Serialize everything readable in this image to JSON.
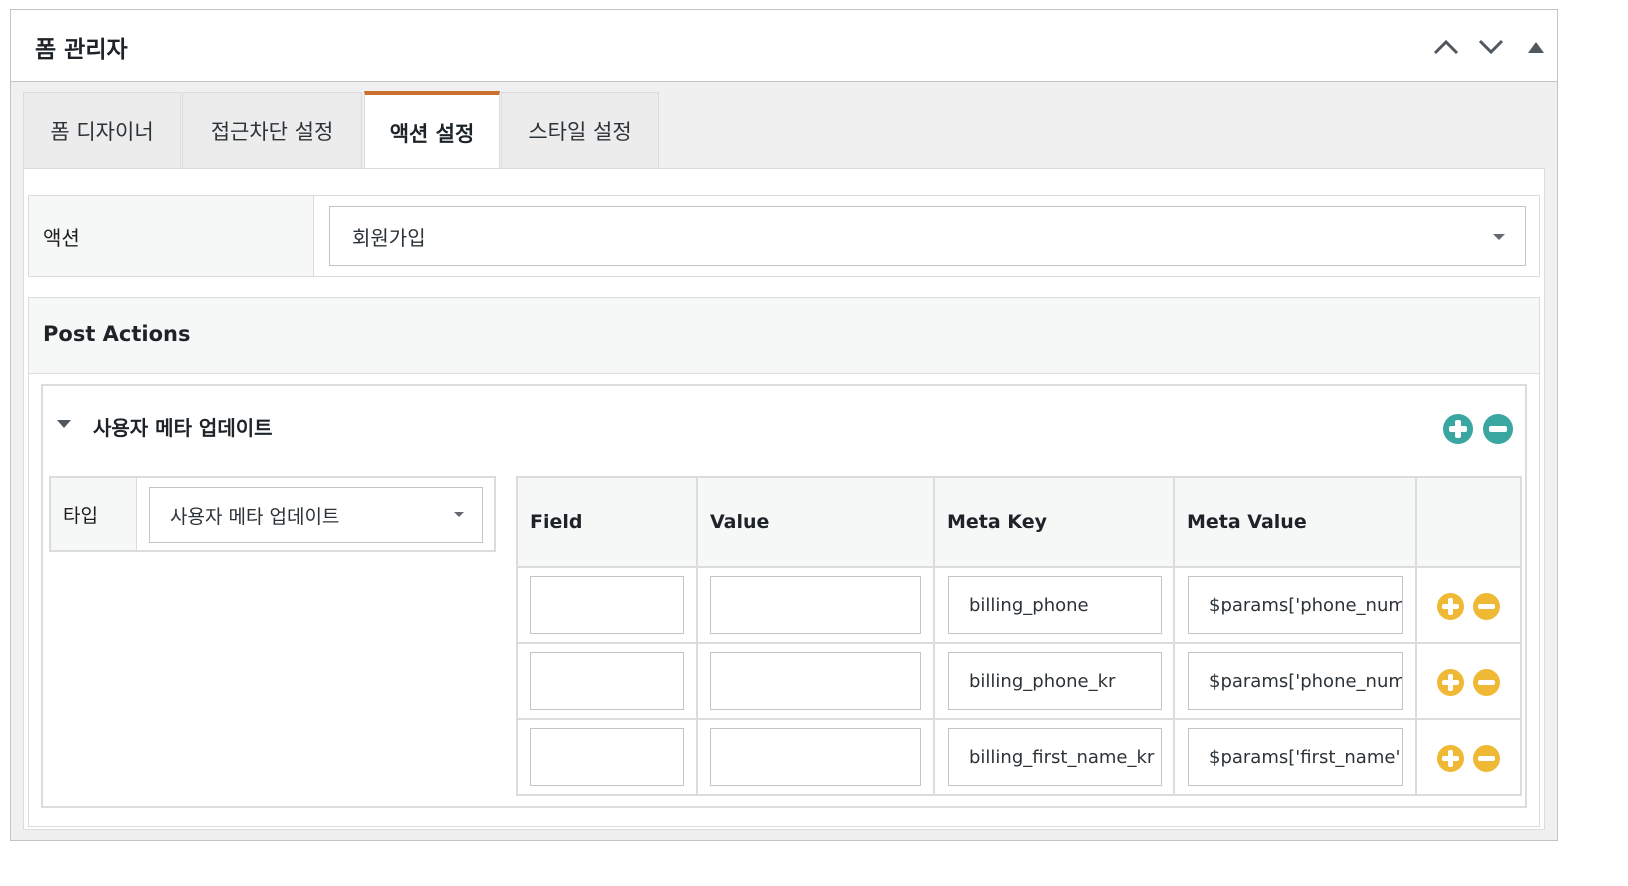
{
  "header": {
    "title": "폼 관리자"
  },
  "tabs": [
    {
      "label": "폼 디자이너"
    },
    {
      "label": "접근차단 설정"
    },
    {
      "label": "액션 설정"
    },
    {
      "label": "스타일 설정"
    }
  ],
  "action_row": {
    "label": "액션",
    "selected": "회원가입"
  },
  "post_actions": {
    "title": "Post Actions",
    "item": {
      "title": "사용자 메타 업데이트",
      "type_label": "타입",
      "type_selected": "사용자 메타 업데이트",
      "columns": [
        "Field",
        "Value",
        "Meta Key",
        "Meta Value"
      ],
      "rows": [
        {
          "field": "",
          "value": "",
          "meta_key": "billing_phone",
          "meta_value": "$params['phone_num"
        },
        {
          "field": "",
          "value": "",
          "meta_key": "billing_phone_kr",
          "meta_value": "$params['phone_num"
        },
        {
          "field": "",
          "value": "",
          "meta_key": "billing_first_name_kr",
          "meta_value": "$params['first_name']"
        }
      ]
    }
  },
  "colors": {
    "accent_tab": "#c9702f",
    "teal": "#3aa6a0",
    "yellow": "#f0b935"
  },
  "icons": [
    "chevron-up-icon",
    "chevron-down-icon",
    "triangle-up-icon",
    "caret-down-icon",
    "plus-circle-icon",
    "minus-circle-icon"
  ]
}
